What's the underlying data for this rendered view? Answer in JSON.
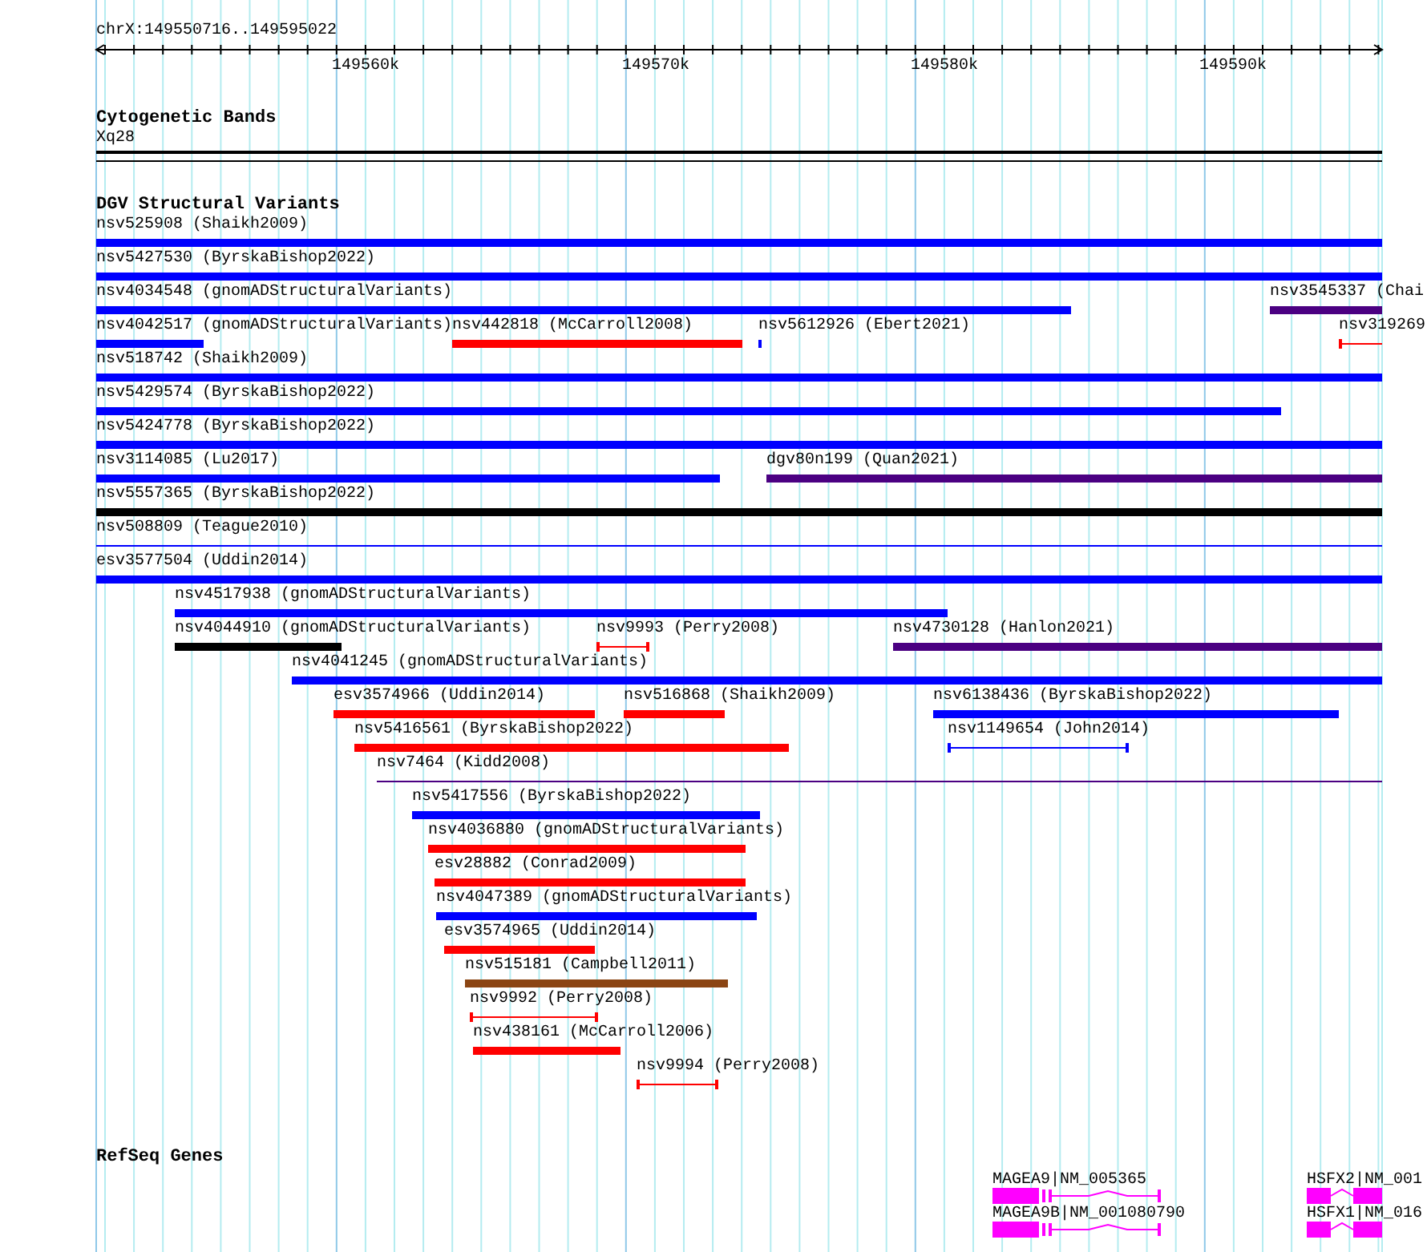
{
  "ruler": {
    "location": "chrX:149550716..149595022",
    "ticks": [
      "149560k",
      "149570k",
      "149580k",
      "149590k"
    ]
  },
  "cytogenetic": {
    "title": "Cytogenetic Bands",
    "bands": [
      {
        "name": "Xq28"
      }
    ]
  },
  "dgv": {
    "title": "DGV Structural Variants",
    "rows": [
      {
        "features": [
          {
            "label": "nsv525908 (Shaikh2009)",
            "kind": "bar",
            "color": "#0000ff"
          }
        ]
      },
      {
        "features": [
          {
            "label": "nsv5427530 (ByrskaBishop2022)",
            "kind": "bar",
            "color": "#0000ff"
          }
        ]
      },
      {
        "features": [
          {
            "label": "nsv4034548 (gnomADStructuralVariants)",
            "kind": "bar",
            "color": "#0000ff"
          },
          {
            "label": "nsv3545337 (Chai",
            "kind": "bar",
            "color": "#4b0082"
          }
        ]
      },
      {
        "features": [
          {
            "label": "nsv4042517 (gnomADStructuralVariants)",
            "kind": "bar",
            "color": "#0000ff"
          },
          {
            "label": "nsv442818 (McCarroll2008)",
            "kind": "bar",
            "color": "#ff0000"
          },
          {
            "label": "nsv5612926 (Ebert2021)",
            "kind": "bar",
            "color": "#0000ff"
          },
          {
            "label": "nsv319269",
            "kind": "whisker",
            "color": "#ff0000"
          }
        ]
      },
      {
        "features": [
          {
            "label": "nsv518742 (Shaikh2009)",
            "kind": "bar",
            "color": "#0000ff"
          }
        ]
      },
      {
        "features": [
          {
            "label": "nsv5429574 (ByrskaBishop2022)",
            "kind": "bar",
            "color": "#0000ff"
          }
        ]
      },
      {
        "features": [
          {
            "label": "nsv5424778 (ByrskaBishop2022)",
            "kind": "bar",
            "color": "#0000ff"
          }
        ]
      },
      {
        "features": [
          {
            "label": "nsv3114085 (Lu2017)",
            "kind": "bar",
            "color": "#0000ff"
          },
          {
            "label": "dgv80n199 (Quan2021)",
            "kind": "bar",
            "color": "#4b0082"
          }
        ]
      },
      {
        "features": [
          {
            "label": "nsv5557365 (ByrskaBishop2022)",
            "kind": "bar",
            "color": "#000000"
          }
        ]
      },
      {
        "features": [
          {
            "label": "nsv508809 (Teague2010)",
            "kind": "line",
            "color": "#0000ff"
          }
        ]
      },
      {
        "features": [
          {
            "label": "esv3577504 (Uddin2014)",
            "kind": "bar",
            "color": "#0000ff"
          }
        ]
      },
      {
        "features": [
          {
            "label": "nsv4517938 (gnomADStructuralVariants)",
            "kind": "bar",
            "color": "#0000ff"
          }
        ]
      },
      {
        "features": [
          {
            "label": "nsv4044910 (gnomADStructuralVariants)",
            "kind": "bar",
            "color": "#000000"
          },
          {
            "label": "nsv9993 (Perry2008)",
            "kind": "whisker",
            "color": "#ff0000"
          },
          {
            "label": "nsv4730128 (Hanlon2021)",
            "kind": "bar",
            "color": "#4b0082"
          }
        ]
      },
      {
        "features": [
          {
            "label": "nsv4041245 (gnomADStructuralVariants)",
            "kind": "bar",
            "color": "#0000ff"
          }
        ]
      },
      {
        "features": [
          {
            "label": "esv3574966 (Uddin2014)",
            "kind": "bar",
            "color": "#ff0000"
          },
          {
            "label": "nsv516868 (Shaikh2009)",
            "kind": "bar",
            "color": "#ff0000"
          },
          {
            "label": "nsv6138436 (ByrskaBishop2022)",
            "kind": "bar",
            "color": "#0000ff"
          }
        ]
      },
      {
        "features": [
          {
            "label": "nsv5416561 (ByrskaBishop2022)",
            "kind": "bar",
            "color": "#ff0000"
          },
          {
            "label": "nsv1149654 (John2014)",
            "kind": "whisker",
            "color": "#0000ff"
          }
        ]
      },
      {
        "features": [
          {
            "label": "nsv7464 (Kidd2008)",
            "kind": "line",
            "color": "#4b0082"
          }
        ]
      },
      {
        "features": [
          {
            "label": "nsv5417556 (ByrskaBishop2022)",
            "kind": "bar",
            "color": "#0000ff"
          }
        ]
      },
      {
        "features": [
          {
            "label": "nsv4036880 (gnomADStructuralVariants)",
            "kind": "bar",
            "color": "#ff0000"
          }
        ]
      },
      {
        "features": [
          {
            "label": "esv28882 (Conrad2009)",
            "kind": "bar",
            "color": "#ff0000"
          }
        ]
      },
      {
        "features": [
          {
            "label": "nsv4047389 (gnomADStructuralVariants)",
            "kind": "bar",
            "color": "#0000ff"
          }
        ]
      },
      {
        "features": [
          {
            "label": "esv3574965 (Uddin2014)",
            "kind": "bar",
            "color": "#ff0000"
          }
        ]
      },
      {
        "features": [
          {
            "label": "nsv515181 (Campbell2011)",
            "kind": "bar",
            "color": "#8b4513"
          }
        ]
      },
      {
        "features": [
          {
            "label": "nsv9992 (Perry2008)",
            "kind": "whisker",
            "color": "#ff0000"
          }
        ]
      },
      {
        "features": [
          {
            "label": "nsv438161 (McCarroll2006)",
            "kind": "bar",
            "color": "#ff0000"
          }
        ]
      },
      {
        "features": [
          {
            "label": "nsv9994 (Perry2008)",
            "kind": "whisker",
            "color": "#ff0000"
          }
        ]
      }
    ]
  },
  "refseq": {
    "title": "RefSeq Genes",
    "rows": [
      {
        "genes": [
          {
            "label": "MAGEA9|NM_005365"
          },
          {
            "label": "HSFX2|NM_001"
          }
        ]
      },
      {
        "genes": [
          {
            "label": "MAGEA9B|NM_001080790"
          },
          {
            "label": "HSFX1|NM_016"
          }
        ]
      }
    ]
  }
}
